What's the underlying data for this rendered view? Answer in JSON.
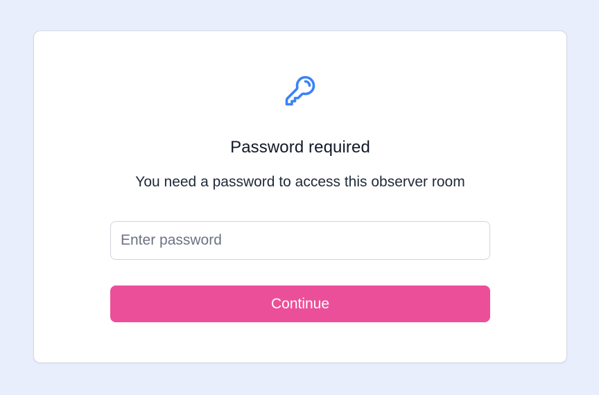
{
  "dialog": {
    "icon": "key-icon",
    "title": "Password required",
    "subtitle": "You need a password to access this observer room",
    "password_input": {
      "value": "",
      "placeholder": "Enter password"
    },
    "continue_label": "Continue"
  },
  "colors": {
    "background": "#e8eefc",
    "card": "#ffffff",
    "accent_icon": "#3b82f6",
    "primary_button": "#ec4f99",
    "text_primary": "#111827"
  }
}
